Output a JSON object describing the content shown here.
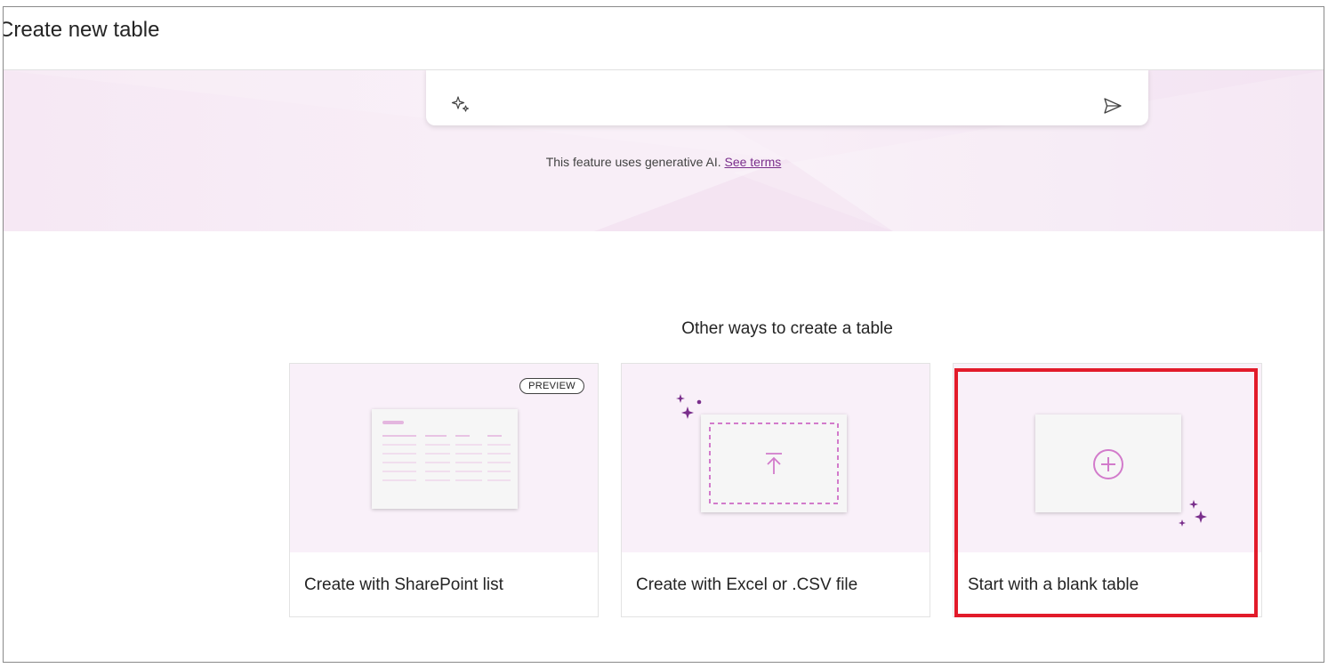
{
  "page": {
    "title": "Create new table"
  },
  "prompt": {
    "disclaimer_text": "This feature uses generative AI.",
    "terms_link": "See terms"
  },
  "section": {
    "title": "Other ways to create a table"
  },
  "cards": [
    {
      "label": "Create with SharePoint list",
      "badge": "PREVIEW"
    },
    {
      "label": "Create with Excel or .CSV file"
    },
    {
      "label": "Start with a blank table",
      "selected": true
    }
  ],
  "colors": {
    "accent": "#7a2f8c",
    "selection": "#e21b2a",
    "hero_background": "#f8eef7"
  },
  "icons": [
    "sparkle-icon",
    "send-icon",
    "upload-icon",
    "add-circle-icon"
  ]
}
